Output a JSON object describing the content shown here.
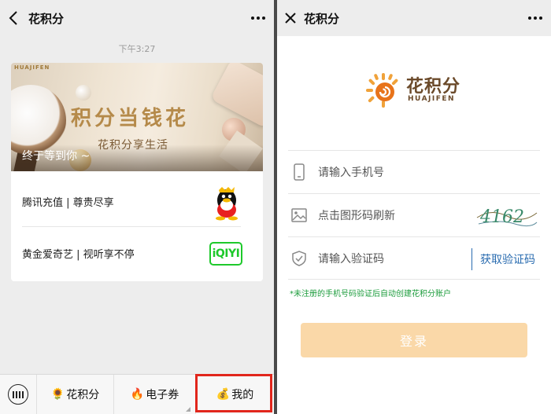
{
  "left": {
    "nav": {
      "back_icon": "chevron-left-icon",
      "title": "花积分",
      "more_icon": "more-dots-icon"
    },
    "timestamp": "下午3:27",
    "card": {
      "banner": {
        "logo_text": "HUAJIFEN",
        "headline": "积分当钱花",
        "subtitle": "花积分享生活",
        "caption": "终于等到你 ~"
      },
      "items": [
        {
          "text": "腾讯充值 | 尊贵尽享",
          "icon": "qq-penguin-icon"
        },
        {
          "text": "黄金爱奇艺 | 视听享不停",
          "icon": "iqiyi-logo-icon"
        }
      ]
    },
    "tabbar": {
      "keyboard_icon": "keyboard-icon",
      "tabs": [
        {
          "emoji": "🌻",
          "label": "花积分"
        },
        {
          "emoji": "🔥",
          "label": "电子券"
        },
        {
          "emoji": "💰",
          "label": "我的"
        }
      ]
    }
  },
  "right": {
    "nav": {
      "close_icon": "close-icon",
      "title": "花积分",
      "more_icon": "more-dots-icon"
    },
    "brand": {
      "name": "花积分",
      "sub": "HUAJIFEN"
    },
    "fields": {
      "phone_placeholder": "请输入手机号",
      "captcha_placeholder": "点击图形码刷新",
      "captcha_value": "4162",
      "code_placeholder": "请输入验证码",
      "get_code": "获取验证码"
    },
    "note": "*未注册的手机号码验证后自动创建花积分账户",
    "login": "登录"
  },
  "colors": {
    "accent": "#f0a23a",
    "login_bg": "#fad8a8",
    "link": "#2a6cb0",
    "note": "#1c9c3c",
    "highlight": "#e1261c"
  }
}
